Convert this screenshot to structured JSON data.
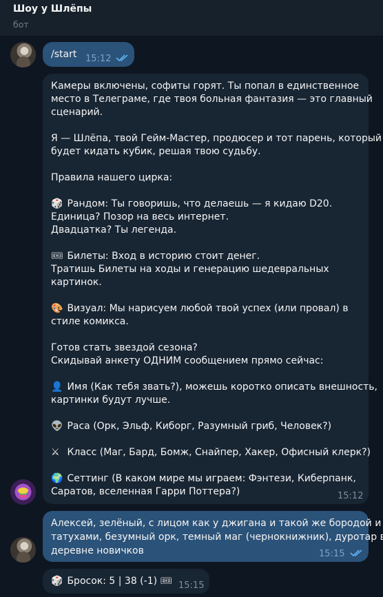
{
  "header": {
    "title": "Шоу у Шлёпы",
    "subtitle": "бот"
  },
  "colors": {
    "background": "#0e1621",
    "header": "#17212b",
    "incoming_bubble": "#182533",
    "outgoing_bubble": "#2b5278",
    "read_ticks": "#5fb3f5",
    "meta_text": "#7d8e9e"
  },
  "messages": {
    "start": {
      "text": "/start",
      "time": "15:12"
    },
    "welcome": {
      "time": "15:12",
      "lines": [
        "Камеры включены, софиты горят. Ты попал в единственное",
        "место в Телеграме, где твоя больная фантазия — это главный",
        "сценарий.",
        "Я — Шлёпа, твой Гейм-Мастер, продюсер и тот парень, который",
        "будет кидать кубик, решая твою судьбу.",
        "Правила нашего цирка:",
        "Рандом: Ты говоришь, что делаешь — я кидаю D20.",
        "Единица? Позор на весь интернет.",
        "Двадцатка? Ты легенда.",
        "Билеты: Вход в историю стоит денег.",
        "Тратишь Билеты на ходы и генерацию шедевральных",
        "картинок.",
        "Визуал: Мы нарисуем любой твой успех (или провал) в",
        "стиле комикса.",
        "Готов стать звездой сезона?",
        "Скидывай анкету ОДНИМ сообщением прямо сейчас:",
        "Имя (Как тебя звать?), можешь коротко описать внешность,",
        "картинки будут лучше.",
        "Раса (Орк, Эльф, Киборг, Разумный гриб, Человек?)",
        "Класс (Маг, Бард, Бомж, Снайпер, Хакер, Офисный клерк?)",
        "Сеттинг (В каком мире мы играем: Фэнтези, Киберпанк,",
        "Саратов, вселенная Гарри Поттера?)"
      ],
      "emojis": {
        "dice": "🎲",
        "ticket": "🎟",
        "palette": "🎨",
        "person": "👤",
        "alien": "👽",
        "swords": "⚔",
        "globe": "🌍"
      }
    },
    "reply": {
      "time": "15:15",
      "lines": [
        "Алексей, зелёный, с лицом как у джигана и такой же бородой и",
        "татухами, безумный орк, темный маг (чернокнижник), дуротар в",
        "деревне новичков"
      ]
    },
    "roll": {
      "dice": "🎲",
      "text": "Бросок: 5 | 38 (-1)",
      "ticket": "🎟",
      "time": "15:15"
    }
  }
}
